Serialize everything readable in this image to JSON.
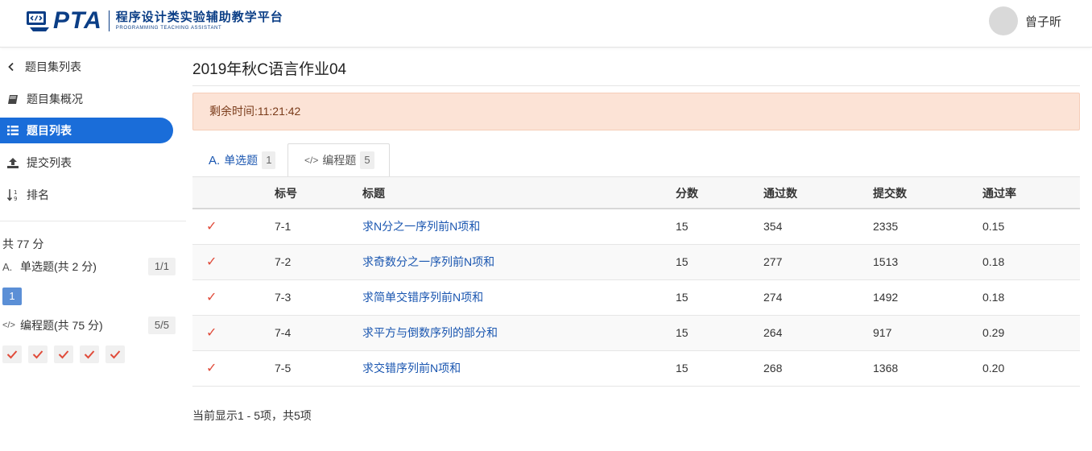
{
  "header": {
    "logo_text": "PTA",
    "logo_title": "程序设计类实验辅助教学平台",
    "logo_subtitle": "PROGRAMMING TEACHING ASSISTANT",
    "user_name": "曾子昕"
  },
  "sidebar": {
    "items": [
      {
        "label": "题目集列表",
        "icon": "chevron-left-icon"
      },
      {
        "label": "题目集概况",
        "icon": "book-icon"
      },
      {
        "label": "题目列表",
        "icon": "list-icon",
        "active": true
      },
      {
        "label": "提交列表",
        "icon": "upload-icon"
      },
      {
        "label": "排名",
        "icon": "sort-numeric-icon"
      }
    ],
    "total": "共 77 分",
    "categories": [
      {
        "icon_text": "A.",
        "label": "单选题(共 2 分)",
        "count": "1/1"
      },
      {
        "icon_text": "</>",
        "label": "编程题(共 75 分)",
        "count": "5/5"
      }
    ],
    "single_choice_numbers": [
      "1"
    ],
    "programming_checks": 5
  },
  "main": {
    "title": "2019年秋C语言作业04",
    "alert": "剩余时间:11:21:42",
    "tabs": [
      {
        "icon_text": "A.",
        "label": "单选题",
        "badge": "1"
      },
      {
        "icon_text": "</>",
        "label": "编程题",
        "badge": "5",
        "selected": true
      }
    ],
    "table": {
      "headers": [
        "标号",
        "标题",
        "分数",
        "通过数",
        "提交数",
        "通过率"
      ],
      "rows": [
        {
          "id": "7-1",
          "title": "求N分之一序列前N项和",
          "score": "15",
          "passed": "354",
          "submitted": "2335",
          "rate": "0.15"
        },
        {
          "id": "7-2",
          "title": "求奇数分之一序列前N项和",
          "score": "15",
          "passed": "277",
          "submitted": "1513",
          "rate": "0.18"
        },
        {
          "id": "7-3",
          "title": "求简单交错序列前N项和",
          "score": "15",
          "passed": "274",
          "submitted": "1492",
          "rate": "0.18"
        },
        {
          "id": "7-4",
          "title": "求平方与倒数序列的部分和",
          "score": "15",
          "passed": "264",
          "submitted": "917",
          "rate": "0.29"
        },
        {
          "id": "7-5",
          "title": "求交错序列前N项和",
          "score": "15",
          "passed": "268",
          "submitted": "1368",
          "rate": "0.20"
        }
      ]
    },
    "footer": "当前显示1 - 5项，共5项"
  },
  "colors": {
    "brand": "#0b3e86",
    "active_nav": "#1a6dd9",
    "link": "#1a56b0",
    "check": "#e04b3a",
    "alert_bg": "#fce3d6"
  }
}
